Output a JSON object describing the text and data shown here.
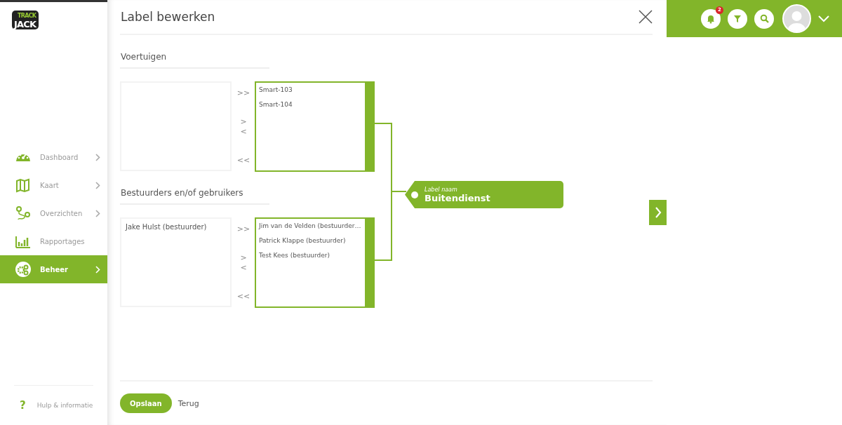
{
  "sidebar": {
    "logo": {
      "top": "TRACK",
      "bottom": "JACK"
    },
    "items": [
      {
        "label": "Dashboard",
        "chevron": true,
        "selected": false
      },
      {
        "label": "Kaart",
        "chevron": true,
        "selected": false
      },
      {
        "label": "Overzichten",
        "chevron": true,
        "selected": false
      },
      {
        "label": "Rapportages",
        "chevron": false,
        "selected": false
      },
      {
        "label": "Beheer",
        "chevron": true,
        "selected": true
      }
    ],
    "help": {
      "icon": "?",
      "label": "Hulp & informatie"
    }
  },
  "dialog": {
    "title": "Label bewerken",
    "sections": [
      {
        "heading": "Voertuigen",
        "assigned": [
          "Smart-103",
          "Smart-104"
        ]
      },
      {
        "heading": "Bestuurders en/of gebruikers",
        "available": [
          "Jake Hulst (bestuurder)"
        ],
        "assigned": [
          "Jim van de Velden (bestuurder…",
          "Patrick Klappe (bestuurder)",
          "Test Kees (bestuurder)"
        ]
      }
    ],
    "transfer_buttons": [
      ">>",
      ">",
      "<",
      "<<"
    ],
    "label_tag": {
      "caption": "Label naam",
      "value": "Buitendienst"
    },
    "buttons": [
      {
        "label": "Opslaan",
        "kind": "primary"
      },
      {
        "label": "Terug",
        "kind": "plain"
      }
    ]
  },
  "header": {
    "notification_count": "2"
  }
}
